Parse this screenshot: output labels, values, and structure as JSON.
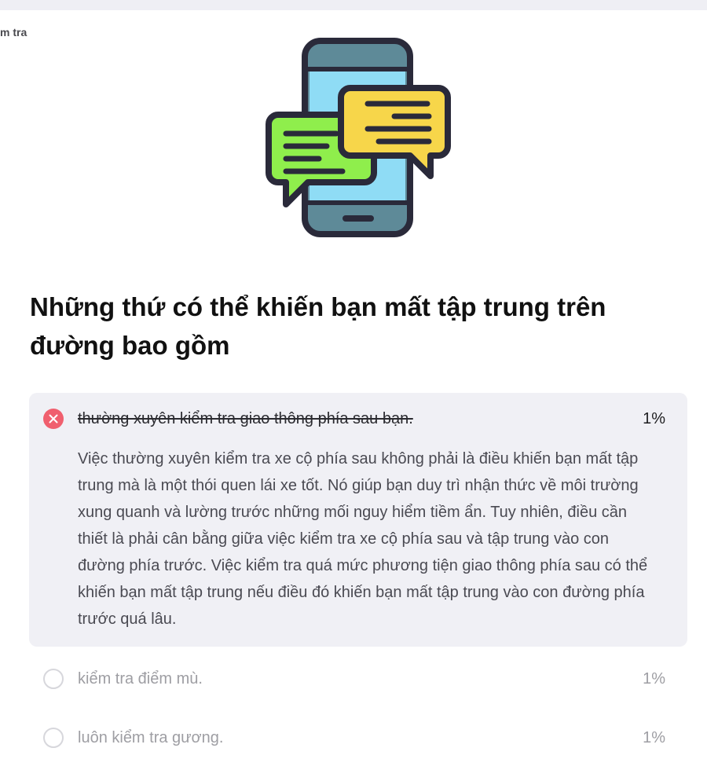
{
  "header": {
    "breadcrumb": "m tra"
  },
  "illustration": {
    "icon": "phone-chat-bubbles-icon"
  },
  "question": {
    "title": "Những thứ có thể khiến bạn mất tập trung trên đường bao gồm"
  },
  "answers": [
    {
      "label": "thường xuyên kiểm tra giao thông phía sau bạn.",
      "percent": "1%",
      "state": "incorrect-selected",
      "explanation": "Việc thường xuyên kiểm tra xe cộ phía sau không phải là điều khiến bạn mất tập trung mà là một thói quen lái xe tốt. Nó giúp bạn duy trì nhận thức về môi trường xung quanh và lường trước những mối nguy hiểm tiềm ẩn. Tuy nhiên, điều cần thiết là phải cân bằng giữa việc kiểm tra xe cộ phía sau và tập trung vào con đường phía trước. Việc kiểm tra quá mức phương tiện giao thông phía sau có thể khiến bạn mất tập trung nếu điều đó khiến bạn mất tập trung vào con đường phía trước quá lâu."
    },
    {
      "label": "kiểm tra điểm mù.",
      "percent": "1%",
      "state": "unselected"
    },
    {
      "label": "luôn kiểm tra gương.",
      "percent": "1%",
      "state": "unselected"
    }
  ],
  "colors": {
    "wrong": "#f05f6e",
    "selected_bg": "#f0f0f5",
    "muted_text": "#9e9ea3"
  }
}
